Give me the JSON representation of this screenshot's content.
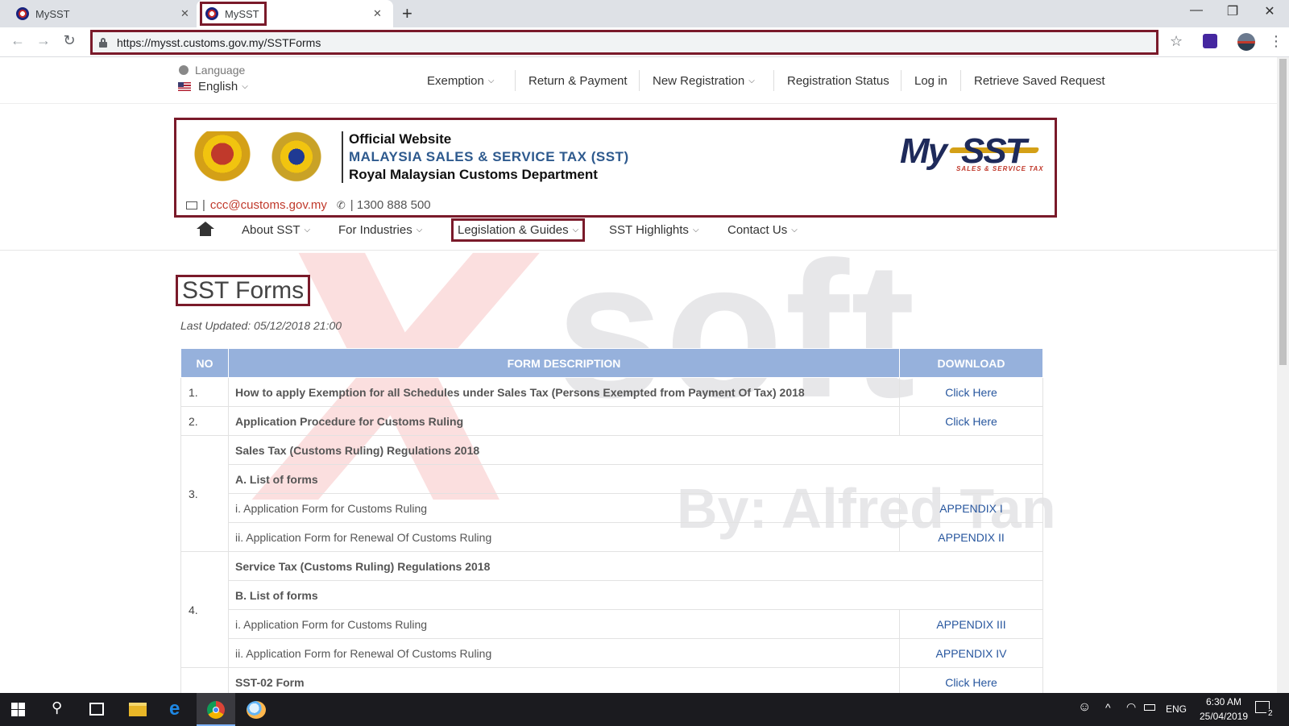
{
  "browser": {
    "tabs": [
      {
        "title": "MySST",
        "active": false
      },
      {
        "title": "MySST",
        "active": true
      }
    ],
    "url": "https://mysst.customs.gov.my/SSTForms",
    "accent": "#7a1a2a"
  },
  "topbar": {
    "language_label": "Language",
    "language_value": "English",
    "nav": [
      "Exemption",
      "Return & Payment",
      "New Registration",
      "Registration Status",
      "Log in",
      "Retrieve Saved Request"
    ]
  },
  "banner": {
    "line1": "Official Website",
    "line2": "MALAYSIA SALES & SERVICE TAX (SST)",
    "line3": "Royal Malaysian Customs Department",
    "email": "ccc@customs.gov.my",
    "phone": "1300 888 500",
    "logo_my": "My",
    "logo_sst": "SST",
    "logo_tagline": "SALES & SERVICE TAX"
  },
  "mainnav": [
    "About SST",
    "For Industries",
    "Legislation & Guides",
    "SST Highlights",
    "Contact Us"
  ],
  "page": {
    "title": "SST Forms",
    "last_updated": "Last Updated: 05/12/2018 21:00"
  },
  "table": {
    "headers": [
      "NO",
      "FORM DESCRIPTION",
      "DOWNLOAD"
    ],
    "row1": {
      "no": "1.",
      "desc": "How to apply Exemption for all Schedules under Sales Tax (Persons Exempted from Payment Of Tax) 2018",
      "dl": "Click Here"
    },
    "row2": {
      "no": "2.",
      "desc": "Application Procedure for Customs Ruling",
      "dl": "Click Here"
    },
    "row3": {
      "no": "3.",
      "heading": "Sales Tax (Customs Ruling) Regulations 2018",
      "subheading": "A. List of forms",
      "items": [
        {
          "desc": "i. Application Form for Customs Ruling",
          "dl": "APPENDIX I"
        },
        {
          "desc": "ii. Application Form for Renewal Of Customs Ruling",
          "dl": "APPENDIX II"
        }
      ]
    },
    "row4": {
      "no": "4.",
      "heading": "Service Tax (Customs Ruling) Regulations 2018",
      "subheading": "B. List of forms",
      "items": [
        {
          "desc": "i. Application Form for Customs Ruling",
          "dl": "APPENDIX III"
        },
        {
          "desc": "ii. Application Form for Renewal Of Customs Ruling",
          "dl": "APPENDIX IV"
        }
      ]
    },
    "row5": {
      "desc": "SST-02 Form",
      "dl": "Click Here"
    }
  },
  "watermark": {
    "text1": "soft",
    "text2": "By: Alfred Tan"
  },
  "taskbar": {
    "lang": "ENG",
    "time": "6:30 AM",
    "date": "25/04/2019",
    "notifications": "2"
  }
}
